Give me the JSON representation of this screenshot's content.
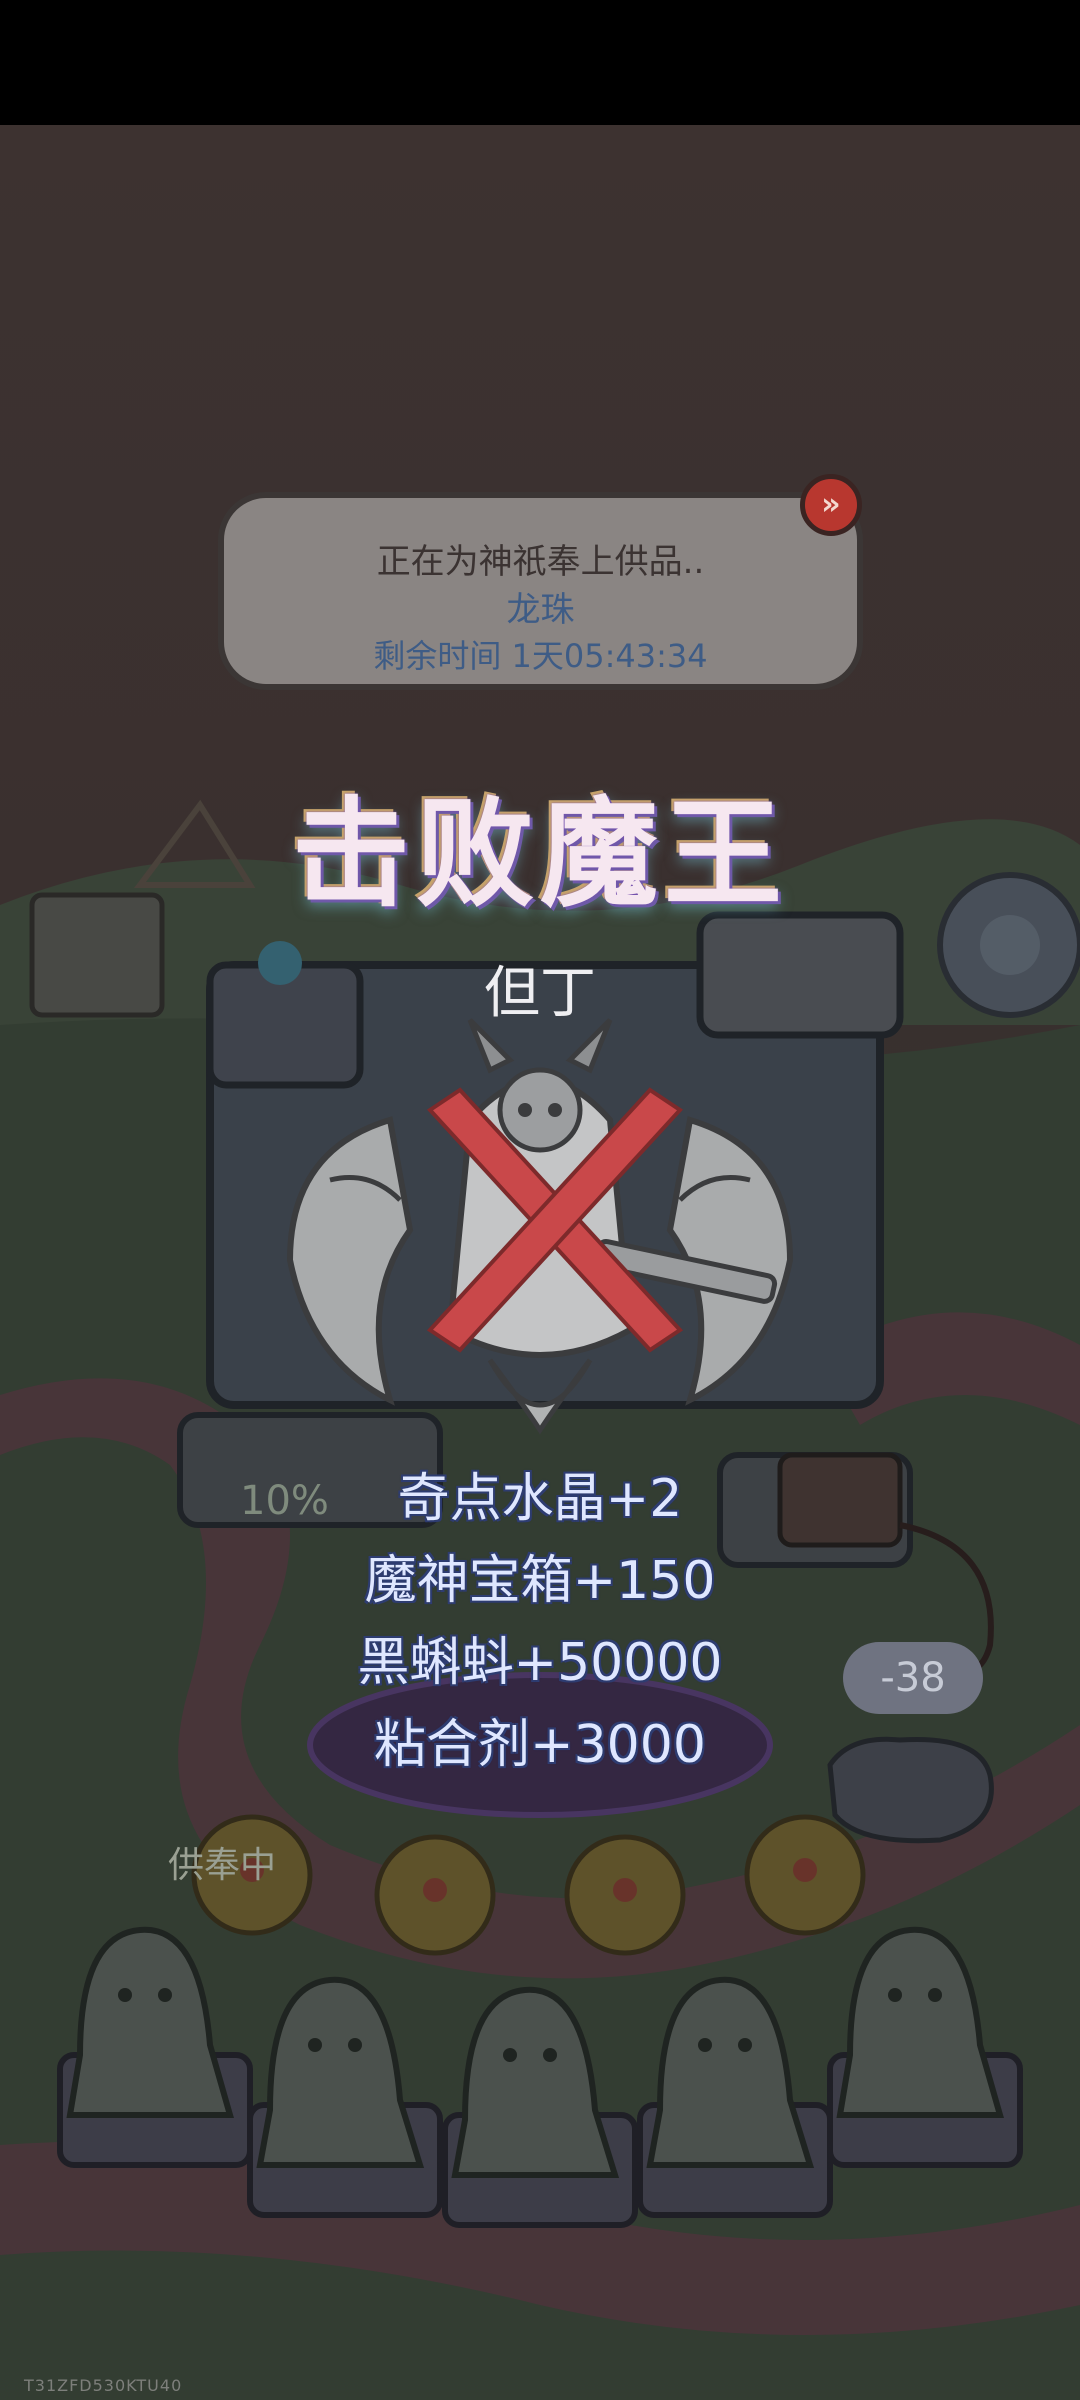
{
  "offering_panel": {
    "status_text": "正在为神祇奉上供品..",
    "item_name": "龙珠",
    "timer_text": "剩余时间 1天05:43:34",
    "skip_icon": "fast-forward-icon"
  },
  "defeat_banner": {
    "title": "击败魔王",
    "boss_name": "但丁"
  },
  "rewards": [
    "奇点水晶+2",
    "魔神宝箱+150",
    "黑蝌蚪+50000",
    "粘合剂+3000"
  ],
  "scene": {
    "progress_label": "10%",
    "badge_value": "-38",
    "offering_tag": "供奉中"
  },
  "footer": {
    "device_id": "T31ZFD530KTU40"
  },
  "colors": {
    "accent_red": "#b8372f",
    "reward_text": "#dfe7ff",
    "cross_mark": "#c9484a"
  }
}
